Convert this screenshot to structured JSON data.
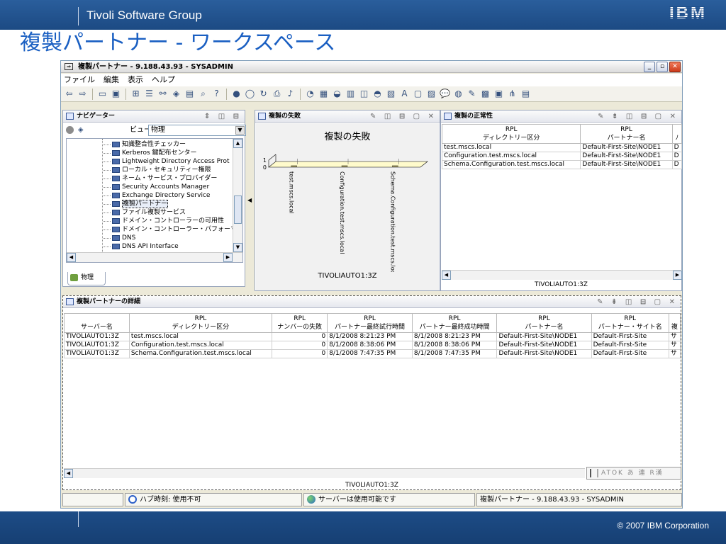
{
  "slide": {
    "group": "Tivoli Software Group",
    "logo": "IBM",
    "title": "複製パートナー - ワークスペース",
    "copyright": "© 2007 IBM Corporation"
  },
  "window": {
    "title": "複製パートナー - 9.188.43.93 - SYSADMIN",
    "menu": [
      "ファイル",
      "編集",
      "表示",
      "ヘルプ"
    ]
  },
  "navigator": {
    "title": "ナビゲーター",
    "view_label": "ビュー:",
    "view_value": "物理",
    "tab": "物理",
    "items": [
      {
        "label": "知識整合性チェッカー"
      },
      {
        "label": "Kerberos 鍵配布センター"
      },
      {
        "label": "Lightweight Directory Access Prot"
      },
      {
        "label": "ローカル・セキュリティー権限"
      },
      {
        "label": "ネーム・サービス・プロバイダー"
      },
      {
        "label": "Security Accounts Manager"
      },
      {
        "label": "Exchange Directory Service"
      },
      {
        "label": "複製パートナー",
        "selected": true
      },
      {
        "label": "ファイル複製サービス"
      },
      {
        "label": "ドメイン・コントローラーの可用性"
      },
      {
        "label": "ドメイン・コントローラー・パフォーマンス"
      },
      {
        "label": "DNS"
      },
      {
        "label": "DNS API Interface"
      }
    ]
  },
  "fail_panel": {
    "title": "複製の失敗",
    "server": "TIVOLIAUTO1:3Z"
  },
  "chart_data": {
    "type": "bar",
    "title": "複製の失敗",
    "categories": [
      "test.mscs.local",
      "Configuration.test.mscs.local",
      "Schema.Configuration.test.mscs.local"
    ],
    "values": [
      0,
      0,
      0
    ],
    "yticks": [
      "1",
      "0"
    ],
    "ylim": [
      0,
      1
    ]
  },
  "health_panel": {
    "title": "複製の正常性",
    "server": "TIVOLIAUTO1:3Z",
    "columns": [
      {
        "top": "RPL",
        "bottom": "ディレクトリー区分"
      },
      {
        "top": "RPL",
        "bottom": "パートナー名"
      },
      {
        "top": "",
        "bottom": "ﾉ"
      }
    ],
    "rows": [
      [
        "test.mscs.local",
        "Default-First-Site\\NODE1",
        "D"
      ],
      [
        "Configuration.test.mscs.local",
        "Default-First-Site\\NODE1",
        "D"
      ],
      [
        "Schema.Configuration.test.mscs.local",
        "Default-First-Site\\NODE1",
        "D"
      ]
    ]
  },
  "detail_panel": {
    "title": "複製パートナーの詳細",
    "server": "TIVOLIAUTO1:3Z",
    "columns": [
      {
        "top": "",
        "bottom": "サーバー名"
      },
      {
        "top": "RPL",
        "bottom": "ディレクトリー区分"
      },
      {
        "top": "RPL",
        "bottom": "ナンバーの失敗"
      },
      {
        "top": "RPL",
        "bottom": "パートナー最終試行時間"
      },
      {
        "top": "RPL",
        "bottom": "パートナー最終成功時間"
      },
      {
        "top": "RPL",
        "bottom": "パートナー名"
      },
      {
        "top": "RPL",
        "bottom": "パートナー・サイト名"
      },
      {
        "top": "",
        "bottom": "複"
      }
    ],
    "rows": [
      [
        "TIVOLIAUTO1:3Z",
        "test.mscs.local",
        "0",
        "8/1/2008 8:21:23 PM",
        "8/1/2008 8:21:23 PM",
        "Default-First-Site\\NODE1",
        "Default-First-Site",
        "サ"
      ],
      [
        "TIVOLIAUTO1:3Z",
        "Configuration.test.mscs.local",
        "0",
        "8/1/2008 8:38:06 PM",
        "8/1/2008 8:38:06 PM",
        "Default-First-Site\\NODE1",
        "Default-First-Site",
        "サ"
      ],
      [
        "TIVOLIAUTO1:3Z",
        "Schema.Configuration.test.mscs.local",
        "0",
        "8/1/2008 7:47:35 PM",
        "8/1/2008 7:47:35 PM",
        "Default-First-Site\\NODE1",
        "Default-First-Site",
        "サ"
      ]
    ],
    "ime": "ATOK あ 連 R漢"
  },
  "status": {
    "hub_time": "ハブ時刻: 使用不可",
    "server_state": "サーバーは使用可能です",
    "location": "複製パートナー - 9.188.43.93 - SYSADMIN"
  }
}
